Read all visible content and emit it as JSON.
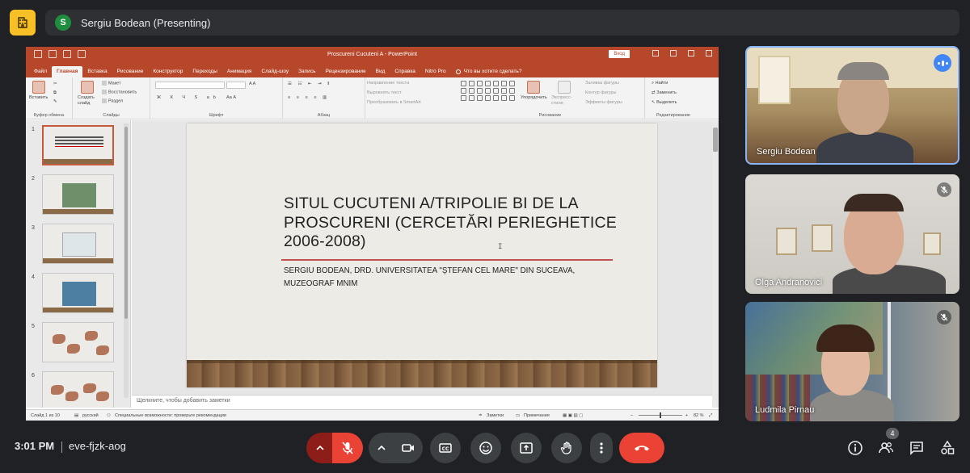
{
  "top_bar": {
    "presenter_initial": "S",
    "presenter_label": "Sergiu Bodean (Presenting)"
  },
  "powerpoint": {
    "window_title": "Proscureni Cucuteni A  -  PowerPoint",
    "view_button": "Вход",
    "tabs": [
      "Файл",
      "Главная",
      "Вставка",
      "Рисование",
      "Конструктор",
      "Переходы",
      "Анимация",
      "Слайд-шоу",
      "Запись",
      "Рецензирование",
      "Вид",
      "Справка",
      "Nitro Pro"
    ],
    "active_tab": "Главная",
    "tell_me": "Что вы хотите сделать?",
    "ribbon": {
      "paste": "Вставить",
      "clipboard_group": "Буфер обмена",
      "new_slide": "Создать слайд",
      "layout": "Макет",
      "reset": "Восстановить",
      "section": "Раздел",
      "slides_group": "Слайды",
      "font_group": "Шрифт",
      "paragraph_group": "Абзац",
      "text_direction": "Направление текста",
      "align_text": "Выровнять текст",
      "smartart": "Преобразовать в SmartArt",
      "arrange": "Упорядочить",
      "quick_styles": "Экспресс-стили",
      "shape_fill": "Заливка фигуры",
      "shape_outline": "Контур фигуры",
      "shape_effects": "Эффекты фигуры",
      "drawing_group": "Рисование",
      "find": "Найти",
      "replace": "Заменить",
      "select": "Выделить",
      "editing_group": "Редактирование"
    },
    "thumbnails": [
      "1",
      "2",
      "3",
      "4",
      "5",
      "6"
    ],
    "slide": {
      "title": "SITUL CUCUTENI A/TRIPOLIE BI DE LA PROSCURENI (CERCETĂRI PERIEGHETICE 2006-2008)",
      "subtitle_line1": "SERGIU BODEAN, DRD. UNIVERSITATEA \"ȘTEFAN CEL MARE\" DIN SUCEAVA,",
      "subtitle_line2": "MUZEOGRAF MNIM"
    },
    "notes_placeholder": "Щелкните, чтобы добавить заметки",
    "status": {
      "slide_count": "Слайд 1 из 10",
      "language": "русский",
      "accessibility": "Специальные возможности: проверьте рекомендации",
      "notes": "Заметки",
      "comments": "Примечания",
      "zoom": "82 %"
    }
  },
  "participants": [
    {
      "name": "Sergiu Bodean",
      "speaking": true
    },
    {
      "name": "Olga Andranovici",
      "muted": true
    },
    {
      "name": "Ludmila Pirnau",
      "muted": true
    }
  ],
  "bottom_bar": {
    "time": "3:01 PM",
    "meeting_code": "eve-fjzk-aog",
    "people_count": "4"
  },
  "colors": {
    "meet_bg": "#202124",
    "ppt_accent": "#b7472a",
    "end_call": "#ea4335",
    "home_button": "#f6c026",
    "active_speaker_border": "#8ab4f8"
  }
}
